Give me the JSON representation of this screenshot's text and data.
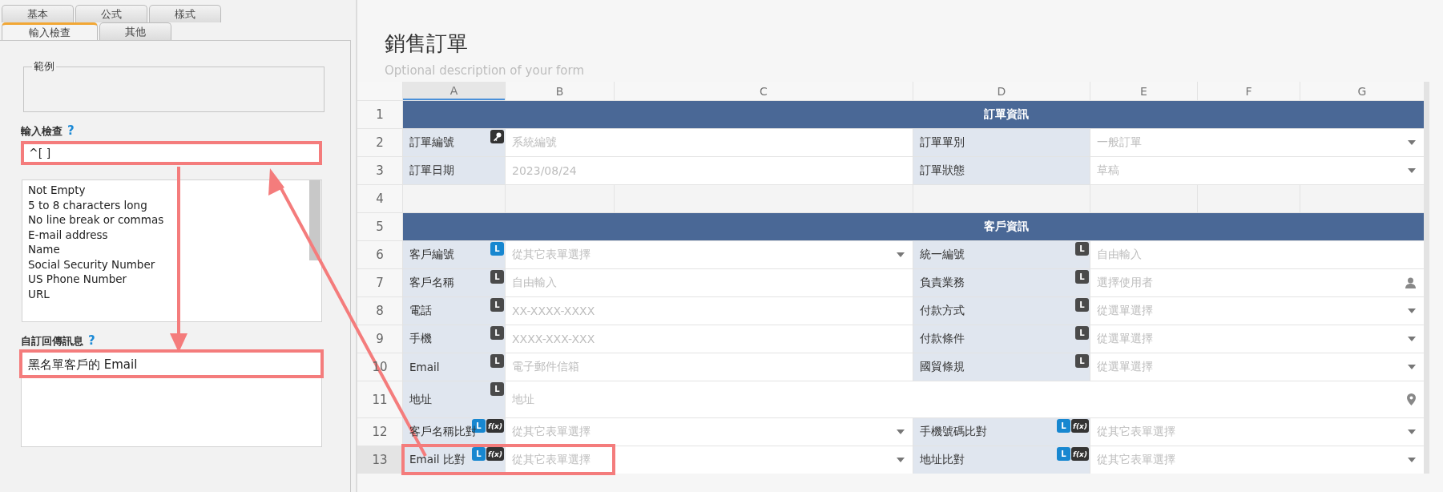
{
  "settings_panel": {
    "tab_rows": [
      {
        "tabs": [
          {
            "label": "基本",
            "selected": false
          },
          {
            "label": "公式",
            "selected": false
          },
          {
            "label": "樣式",
            "selected": false
          }
        ]
      },
      {
        "tabs": [
          {
            "label": "輸入檢查",
            "selected": true
          },
          {
            "label": "其他",
            "selected": false
          }
        ]
      }
    ],
    "example": {
      "legend": "範例"
    },
    "validation": {
      "label": "輸入檢查",
      "help": "?",
      "value": "^[ ]",
      "highlighted": true
    },
    "presets": [
      {
        "label": "Not Empty",
        "selected": false
      },
      {
        "label": "5 to 8 characters long",
        "selected": false
      },
      {
        "label": "No line break or commas",
        "selected": false
      },
      {
        "label": "E-mail address",
        "selected": false
      },
      {
        "label": "Name",
        "selected": false
      },
      {
        "label": "Social Security Number",
        "selected": false
      },
      {
        "label": "US Phone Number",
        "selected": false
      },
      {
        "label": "URL",
        "selected": false
      }
    ],
    "message": {
      "label": "自訂回傳訊息",
      "help": "?",
      "value": "黑名單客戶的 Email",
      "highlighted": true
    }
  },
  "form": {
    "title": "銷售訂單",
    "description": "Optional description of your form",
    "columns": [
      {
        "label": "A",
        "selected": true
      },
      {
        "label": "B",
        "selected": false
      },
      {
        "label": "C",
        "selected": false
      },
      {
        "label": "D",
        "selected": false
      },
      {
        "label": "E",
        "selected": false
      },
      {
        "label": "F",
        "selected": false
      },
      {
        "label": "G",
        "selected": false
      }
    ],
    "rows": [
      {
        "number": "1",
        "selected": false,
        "highlighted": false,
        "kind": "section",
        "title": "訂單資訊"
      },
      {
        "number": "2",
        "selected": false,
        "highlighted": false,
        "kind": "fields",
        "fields": [
          {
            "label": "訂單編號",
            "badges": [
              {
                "kind": "key"
              }
            ],
            "placeholder": "系統編號",
            "kind": "text"
          },
          {
            "label": "訂單單別",
            "placeholder": "一般訂單",
            "kind": "dropdown"
          }
        ]
      },
      {
        "number": "3",
        "selected": false,
        "highlighted": false,
        "kind": "fields",
        "fields": [
          {
            "label": "訂單日期",
            "placeholder": "2023/08/24",
            "kind": "text"
          },
          {
            "label": "訂單狀態",
            "placeholder": "草稿",
            "kind": "dropdown"
          }
        ]
      },
      {
        "number": "4",
        "selected": false,
        "highlighted": false,
        "kind": "empty"
      },
      {
        "number": "5",
        "selected": false,
        "highlighted": false,
        "kind": "section",
        "title": "客戶資訊"
      },
      {
        "number": "6",
        "selected": false,
        "highlighted": false,
        "kind": "fields",
        "fields": [
          {
            "label": "客戶編號",
            "badges": [
              {
                "kind": "letter",
                "text": "L",
                "color": "#1787d0"
              }
            ],
            "placeholder": "從其它表單選擇",
            "kind": "dropdown"
          },
          {
            "label": "統一編號",
            "badges": [
              {
                "kind": "letter",
                "text": "L",
                "color": "#4a4a4a"
              }
            ],
            "placeholder": "自由輸入",
            "kind": "text"
          }
        ]
      },
      {
        "number": "7",
        "selected": false,
        "highlighted": false,
        "kind": "fields",
        "fields": [
          {
            "label": "客戶名稱",
            "badges": [
              {
                "kind": "letter",
                "text": "L",
                "color": "#4a4a4a"
              }
            ],
            "placeholder": "自由輸入",
            "kind": "text"
          },
          {
            "label": "負責業務",
            "badges": [
              {
                "kind": "letter",
                "text": "L",
                "color": "#4a4a4a"
              }
            ],
            "placeholder": "選擇使用者",
            "kind": "user"
          }
        ]
      },
      {
        "number": "8",
        "selected": false,
        "highlighted": false,
        "kind": "fields",
        "fields": [
          {
            "label": "電話",
            "badges": [
              {
                "kind": "letter",
                "text": "L",
                "color": "#4a4a4a"
              }
            ],
            "placeholder": "XX-XXXX-XXXX",
            "kind": "text"
          },
          {
            "label": "付款方式",
            "badges": [
              {
                "kind": "letter",
                "text": "L",
                "color": "#4a4a4a"
              }
            ],
            "placeholder": "從選單選擇",
            "kind": "dropdown"
          }
        ]
      },
      {
        "number": "9",
        "selected": false,
        "highlighted": false,
        "kind": "fields",
        "fields": [
          {
            "label": "手機",
            "badges": [
              {
                "kind": "letter",
                "text": "L",
                "color": "#4a4a4a"
              }
            ],
            "placeholder": "XXXX-XXX-XXX",
            "kind": "text"
          },
          {
            "label": "付款條件",
            "badges": [
              {
                "kind": "letter",
                "text": "L",
                "color": "#4a4a4a"
              }
            ],
            "placeholder": "從選單選擇",
            "kind": "dropdown"
          }
        ]
      },
      {
        "number": "10",
        "selected": false,
        "highlighted": false,
        "kind": "fields",
        "fields": [
          {
            "label": "Email",
            "badges": [
              {
                "kind": "letter",
                "text": "L",
                "color": "#4a4a4a"
              }
            ],
            "placeholder": "電子郵件信箱",
            "kind": "text"
          },
          {
            "label": "國貿條規",
            "badges": [
              {
                "kind": "letter",
                "text": "L",
                "color": "#4a4a4a"
              }
            ],
            "placeholder": "從選單選擇",
            "kind": "dropdown"
          }
        ]
      },
      {
        "number": "11",
        "selected": false,
        "highlighted": false,
        "kind": "fields",
        "fields": [
          {
            "label": "地址",
            "badges": [
              {
                "kind": "letter",
                "text": "L",
                "color": "#4a4a4a"
              }
            ],
            "placeholder": "地址",
            "kind": "location"
          }
        ]
      },
      {
        "number": "12",
        "selected": false,
        "highlighted": false,
        "kind": "fields",
        "fields": [
          {
            "label": "客戶名稱比對",
            "badges": [
              {
                "kind": "letter",
                "text": "L",
                "color": "#1787d0"
              },
              {
                "kind": "formula",
                "text": "f(x)"
              }
            ],
            "placeholder": "從其它表單選擇",
            "kind": "dropdown"
          },
          {
            "label": "手機號碼比對",
            "badges": [
              {
                "kind": "letter",
                "text": "L",
                "color": "#1787d0"
              },
              {
                "kind": "formula",
                "text": "f(x)"
              }
            ],
            "placeholder": "從其它表單選擇",
            "kind": "dropdown"
          }
        ]
      },
      {
        "number": "13",
        "selected": true,
        "highlighted": true,
        "kind": "fields",
        "fields": [
          {
            "label": "Email 比對",
            "badges": [
              {
                "kind": "letter",
                "text": "L",
                "color": "#1787d0"
              },
              {
                "kind": "formula",
                "text": "f(x)"
              }
            ],
            "placeholder": "從其它表單選擇",
            "kind": "dropdown"
          },
          {
            "label": "地址比對",
            "badges": [
              {
                "kind": "letter",
                "text": "L",
                "color": "#1787d0"
              },
              {
                "kind": "formula",
                "text": "f(x)"
              }
            ],
            "placeholder": "從其它表單選擇",
            "kind": "dropdown"
          }
        ]
      }
    ]
  }
}
